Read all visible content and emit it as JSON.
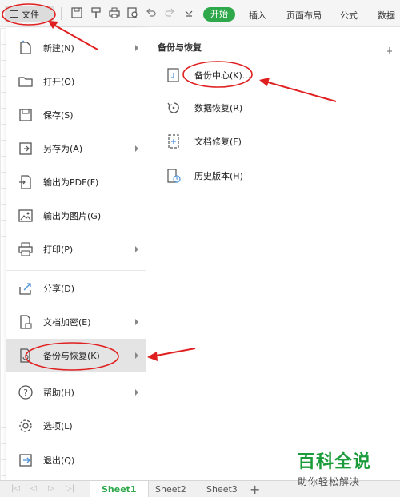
{
  "toolbar": {
    "file_label": "文件",
    "start_label": "开始",
    "tabs": [
      "插入",
      "页面布局",
      "公式",
      "数据"
    ]
  },
  "file_menu": {
    "items": [
      {
        "label": "新建(N)",
        "icon": "new-file-icon",
        "submenu": true
      },
      {
        "label": "打开(O)",
        "icon": "open-folder-icon",
        "submenu": false
      },
      {
        "label": "保存(S)",
        "icon": "save-icon",
        "submenu": false
      },
      {
        "label": "另存为(A)",
        "icon": "save-as-icon",
        "submenu": true
      },
      {
        "label": "输出为PDF(F)",
        "icon": "export-pdf-icon",
        "submenu": false
      },
      {
        "label": "输出为图片(G)",
        "icon": "export-image-icon",
        "submenu": false
      },
      {
        "label": "打印(P)",
        "icon": "print-icon",
        "submenu": true
      },
      {
        "label": "分享(D)",
        "icon": "share-icon",
        "submenu": false
      },
      {
        "label": "文档加密(E)",
        "icon": "encrypt-icon",
        "submenu": true
      },
      {
        "label": "备份与恢复(K)",
        "icon": "backup-icon",
        "submenu": true
      },
      {
        "label": "帮助(H)",
        "icon": "help-icon",
        "submenu": true
      },
      {
        "label": "选项(L)",
        "icon": "options-gear-icon",
        "submenu": false
      },
      {
        "label": "退出(Q)",
        "icon": "exit-icon",
        "submenu": false
      }
    ],
    "highlighted": "备份与恢复(K)"
  },
  "submenu": {
    "title": "备份与恢复",
    "items": [
      {
        "label": "备份中心(K)...",
        "icon": "backup-center-icon"
      },
      {
        "label": "数据恢复(R)",
        "icon": "data-recovery-icon"
      },
      {
        "label": "文档修复(F)",
        "icon": "doc-repair-icon"
      },
      {
        "label": "历史版本(H)",
        "icon": "history-version-icon"
      }
    ]
  },
  "sheets": {
    "tabs": [
      "Sheet1",
      "Sheet2",
      "Sheet3"
    ],
    "active": "Sheet1",
    "add_label": "+"
  },
  "colors": {
    "accent": "#2ea84a",
    "annotation_red": "#e02020",
    "highlight": "#e4e4e4"
  },
  "watermark": {
    "title": "百科全说",
    "subtitle": "助你轻松解决"
  }
}
